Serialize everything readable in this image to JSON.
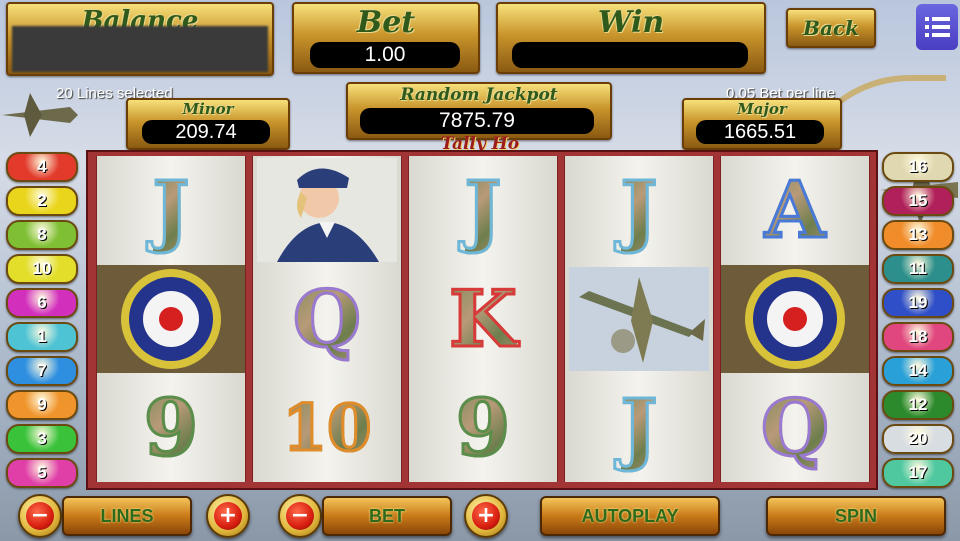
{
  "header": {
    "balance_label": "Balance",
    "bet_label": "Bet",
    "bet_value": "1.00",
    "win_label": "Win",
    "win_value": "",
    "back_label": "Back"
  },
  "info": {
    "lines_selected": "20 Lines selected",
    "bet_per_line": "0.05 Bet per line"
  },
  "jackpots": {
    "minor_label": "Minor",
    "minor_value": "209.74",
    "random_label": "Random Jackpot",
    "random_value": "7875.79",
    "major_label": "Major",
    "major_value": "1665.51"
  },
  "game_title": "Tally Ho",
  "left_lines": [
    {
      "n": "4",
      "color": "#e23b2c"
    },
    {
      "n": "2",
      "color": "#e9d51c"
    },
    {
      "n": "8",
      "color": "#7fbf34"
    },
    {
      "n": "10",
      "color": "#e2de2a"
    },
    {
      "n": "6",
      "color": "#d22fbd"
    },
    {
      "n": "1",
      "color": "#4ec3d4"
    },
    {
      "n": "7",
      "color": "#2e8fe0"
    },
    {
      "n": "9",
      "color": "#f0942c"
    },
    {
      "n": "3",
      "color": "#3bc23b"
    },
    {
      "n": "5",
      "color": "#e03fa8"
    }
  ],
  "right_lines": [
    {
      "n": "16",
      "color": "#e0d8b0"
    },
    {
      "n": "15",
      "color": "#b0205a"
    },
    {
      "n": "13",
      "color": "#f08c2a"
    },
    {
      "n": "11",
      "color": "#2c8f8c"
    },
    {
      "n": "19",
      "color": "#2f4fc8"
    },
    {
      "n": "18",
      "color": "#e0477e"
    },
    {
      "n": "14",
      "color": "#2aa0d8"
    },
    {
      "n": "12",
      "color": "#2c8a2c"
    },
    {
      "n": "20",
      "color": "#d8dde2"
    },
    {
      "n": "17",
      "color": "#4fc8a0"
    }
  ],
  "reels": [
    [
      {
        "kind": "letter",
        "text": "J",
        "stroke": "#6fb7d8"
      },
      {
        "kind": "roundel"
      },
      {
        "kind": "letter",
        "text": "9",
        "stroke": "#5a8e4a"
      }
    ],
    [
      {
        "kind": "pilot"
      },
      {
        "kind": "letter",
        "text": "Q",
        "stroke": "#9a7ad0"
      },
      {
        "kind": "letter",
        "text": "10",
        "stroke": "#e08c2a"
      }
    ],
    [
      {
        "kind": "letter",
        "text": "J",
        "stroke": "#6fb7d8"
      },
      {
        "kind": "letter",
        "text": "K",
        "stroke": "#d83a3a"
      },
      {
        "kind": "letter",
        "text": "9",
        "stroke": "#5a8e4a"
      }
    ],
    [
      {
        "kind": "letter",
        "text": "J",
        "stroke": "#6fb7d8"
      },
      {
        "kind": "plane"
      },
      {
        "kind": "letter",
        "text": "J",
        "stroke": "#6fb7d8"
      }
    ],
    [
      {
        "kind": "letter",
        "text": "A",
        "stroke": "#4a7ad8"
      },
      {
        "kind": "roundel"
      },
      {
        "kind": "letter",
        "text": "Q",
        "stroke": "#9a7ad0"
      }
    ]
  ],
  "controls": {
    "lines_label": "LINES",
    "bet_label": "BET",
    "autoplay_label": "AUTOPLAY",
    "spin_label": "SPIN",
    "minus_symbol": "−",
    "plus_symbol": "+"
  },
  "icons": {
    "menu": "menu-icon",
    "minus": "minus-icon",
    "plus": "plus-icon"
  }
}
